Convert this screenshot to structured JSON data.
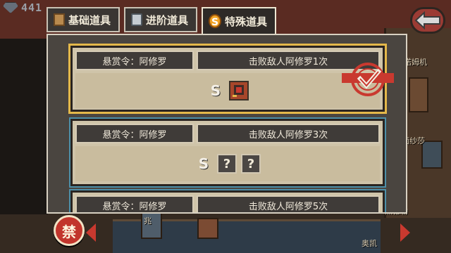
{
  "hud": {
    "gem_count": "441",
    "gem_icon": "gem-icon",
    "back_icon": "back-arrow-icon"
  },
  "tabs": [
    {
      "label": "基础道具",
      "icon": "box-icon",
      "active": false
    },
    {
      "label": "进阶道具",
      "icon": "lock-icon",
      "active": false
    },
    {
      "label": "特殊道具",
      "icon": "s-coin-icon",
      "active": true
    }
  ],
  "quests": [
    {
      "name": "悬赏令：阿修罗",
      "desc": "击败敌人阿修罗1次",
      "status": "completed",
      "rewards": [
        {
          "type": "s-coin",
          "label": "S"
        },
        {
          "type": "item",
          "label": ""
        }
      ]
    },
    {
      "name": "悬赏令：阿修罗",
      "desc": "击败敌人阿修罗3次",
      "status": "active",
      "rewards": [
        {
          "type": "s-coin",
          "label": "S"
        },
        {
          "type": "unknown",
          "label": "?"
        },
        {
          "type": "unknown",
          "label": "?"
        }
      ]
    },
    {
      "name": "悬赏令：阿修罗",
      "desc": "击败敌人阿修罗5次",
      "status": "active",
      "rewards": []
    }
  ],
  "scene_labels": [
    "吉诺姆机",
    "面纱莎",
    "黑德勒",
    "兆",
    "奥凯"
  ],
  "forbid_label": "禁",
  "colors": {
    "panel": "#4a4540",
    "accent_done": "#e4b84a",
    "accent_active": "#4d8fa8",
    "stamp_red": "#c9392f"
  }
}
